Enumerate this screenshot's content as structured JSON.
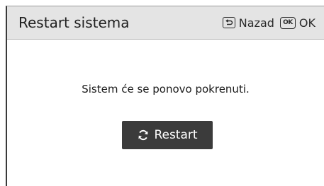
{
  "dialog": {
    "title": "Restart sistema",
    "hints": {
      "back_label": "Nazad",
      "back_icon": "back-key-icon",
      "ok_key_text": "OK",
      "ok_label": "OK",
      "ok_icon": "ok-key-icon"
    },
    "message": "Sistem će se ponovo pokrenuti.",
    "restart_button": {
      "label": "Restart",
      "icon": "refresh-icon"
    }
  },
  "colors": {
    "header_background": "#e4e4e4",
    "button_background": "#3b3b3b",
    "button_text": "#ffffff"
  }
}
